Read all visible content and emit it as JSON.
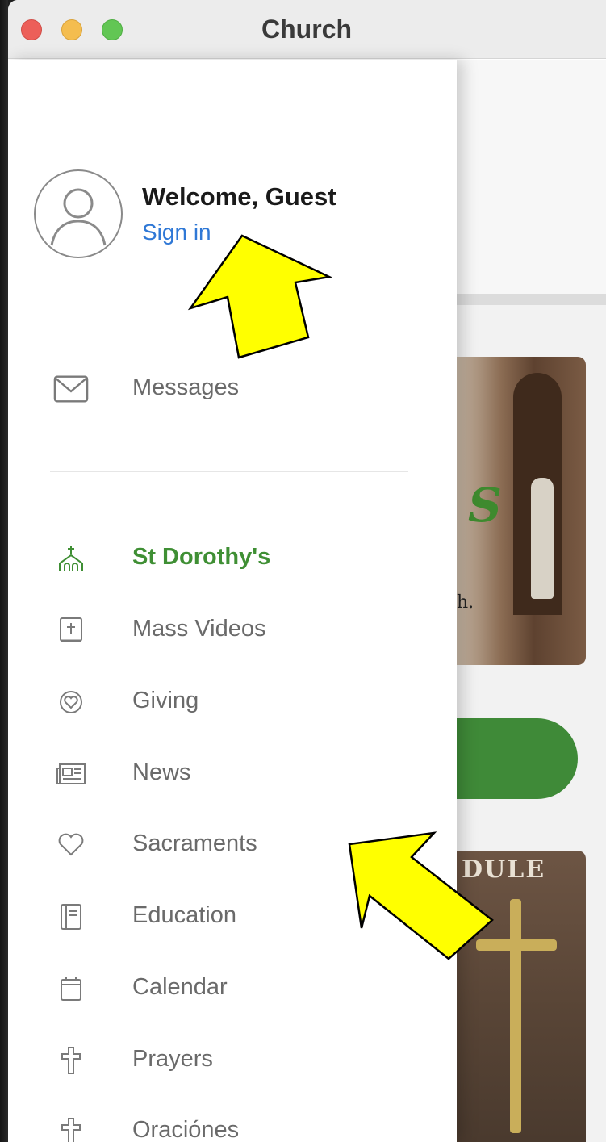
{
  "window": {
    "title": "Church"
  },
  "profile": {
    "welcome": "Welcome, Guest",
    "sign_in": "Sign in"
  },
  "menu": {
    "messages": "Messages",
    "items": [
      {
        "label": "St Dorothy's",
        "icon": "church-icon",
        "active": true
      },
      {
        "label": "Mass Videos",
        "icon": "bible-icon"
      },
      {
        "label": "Giving",
        "icon": "giving-heart-icon"
      },
      {
        "label": "News",
        "icon": "newspaper-icon"
      },
      {
        "label": "Sacraments",
        "icon": "heart-icon"
      },
      {
        "label": "Education",
        "icon": "book-icon"
      },
      {
        "label": "Calendar",
        "icon": "calendar-icon"
      },
      {
        "label": "Prayers",
        "icon": "cross-icon"
      },
      {
        "label": "Oraciónes",
        "icon": "cross-icon"
      }
    ]
  },
  "background": {
    "card1_caption": "h.",
    "card2_title": "DULE"
  },
  "colors": {
    "accent_green": "#3f8f34",
    "link_blue": "#2f78d6",
    "annotation_yellow": "#ffff00"
  }
}
